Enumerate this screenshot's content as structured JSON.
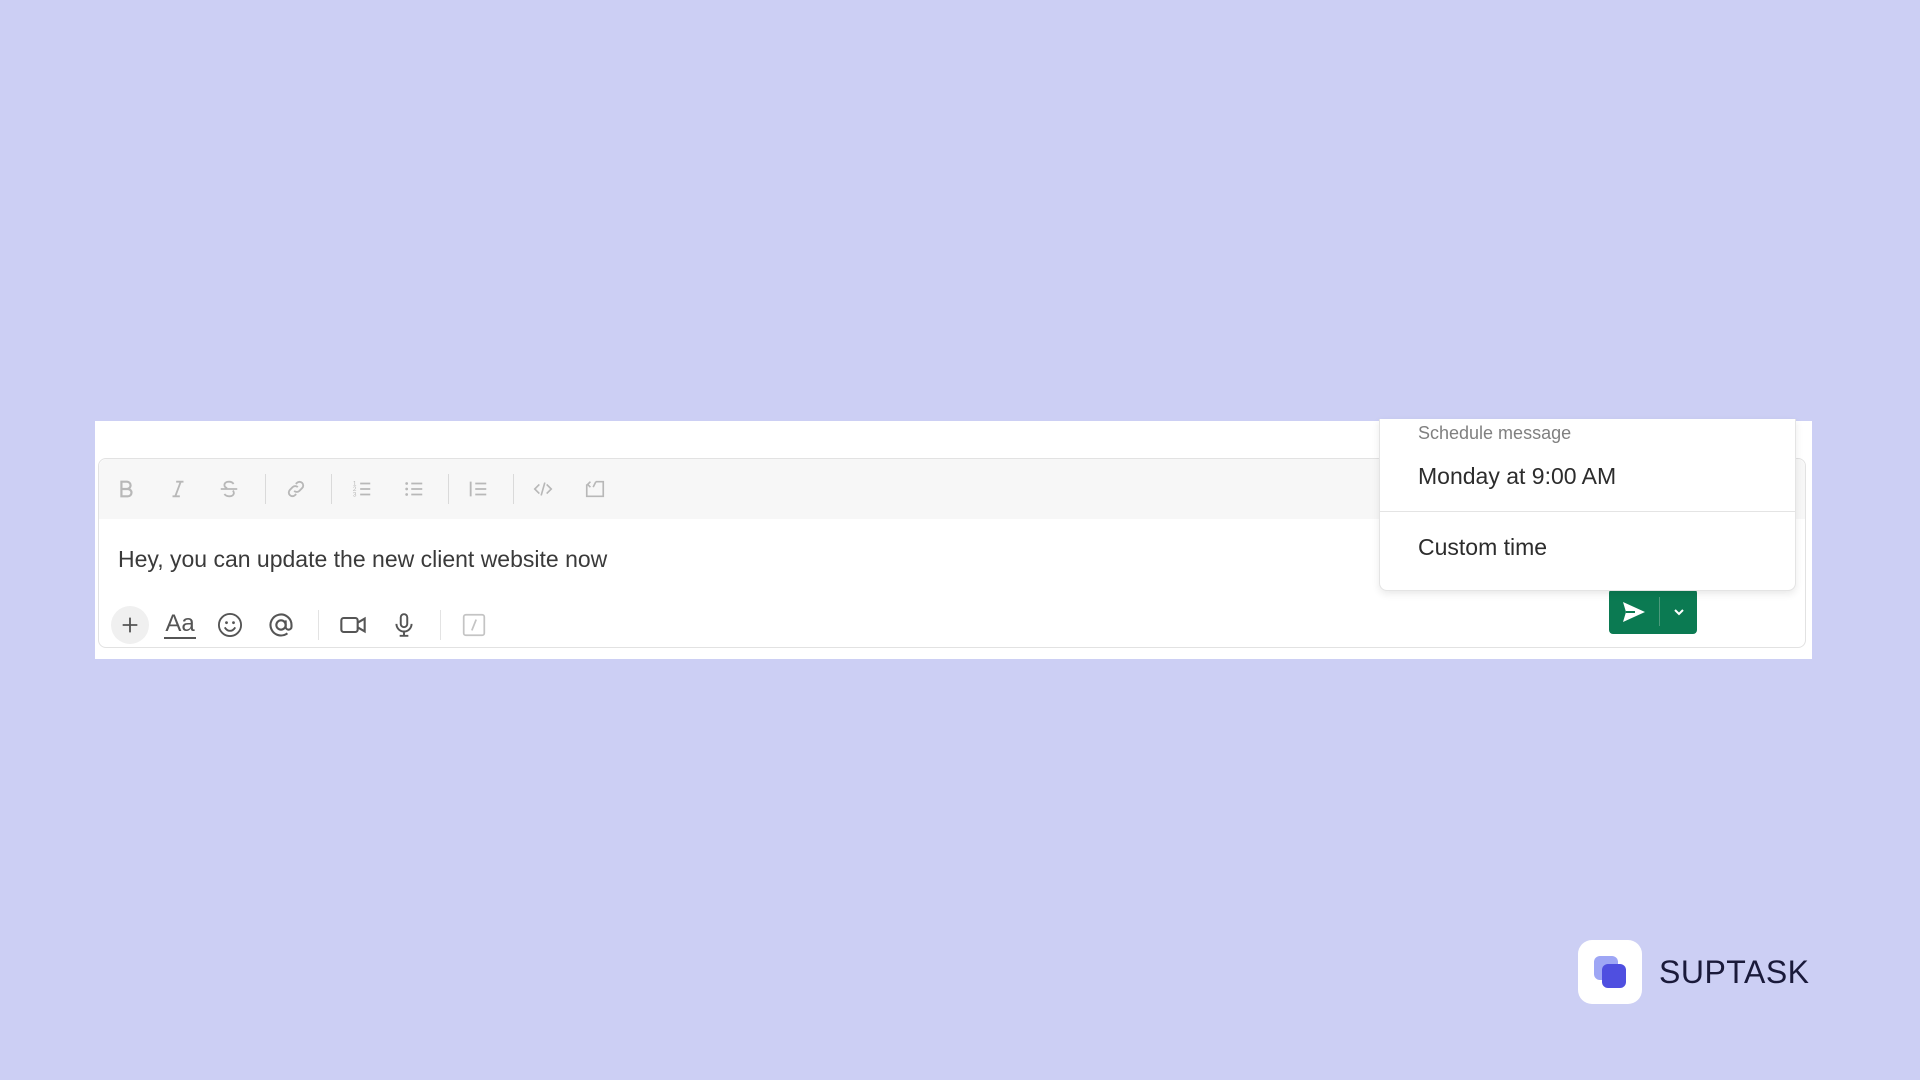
{
  "composer": {
    "message_text": "Hey, you can update the new client website now",
    "format_icons": [
      "bold-icon",
      "italic-icon",
      "strikethrough-icon",
      "link-icon",
      "ordered-list-icon",
      "bulleted-list-icon",
      "blockquote-icon",
      "code-icon",
      "code-block-icon"
    ],
    "action_icons": [
      "plus-icon",
      "text-format-icon",
      "emoji-icon",
      "mention-icon",
      "video-icon",
      "microphone-icon",
      "slash-command-icon"
    ],
    "text_format_label": "Aa"
  },
  "schedule_menu": {
    "header": "Schedule message",
    "option_monday": "Monday at 9:00 AM",
    "option_custom": "Custom time"
  },
  "send": {
    "icons": [
      "send-icon",
      "chevron-down-icon"
    ],
    "accent": "#0b7a52"
  },
  "brand": {
    "name": "SUPTASK",
    "accent": "#4f4fe0"
  },
  "colors": {
    "background": "#cccff4"
  }
}
